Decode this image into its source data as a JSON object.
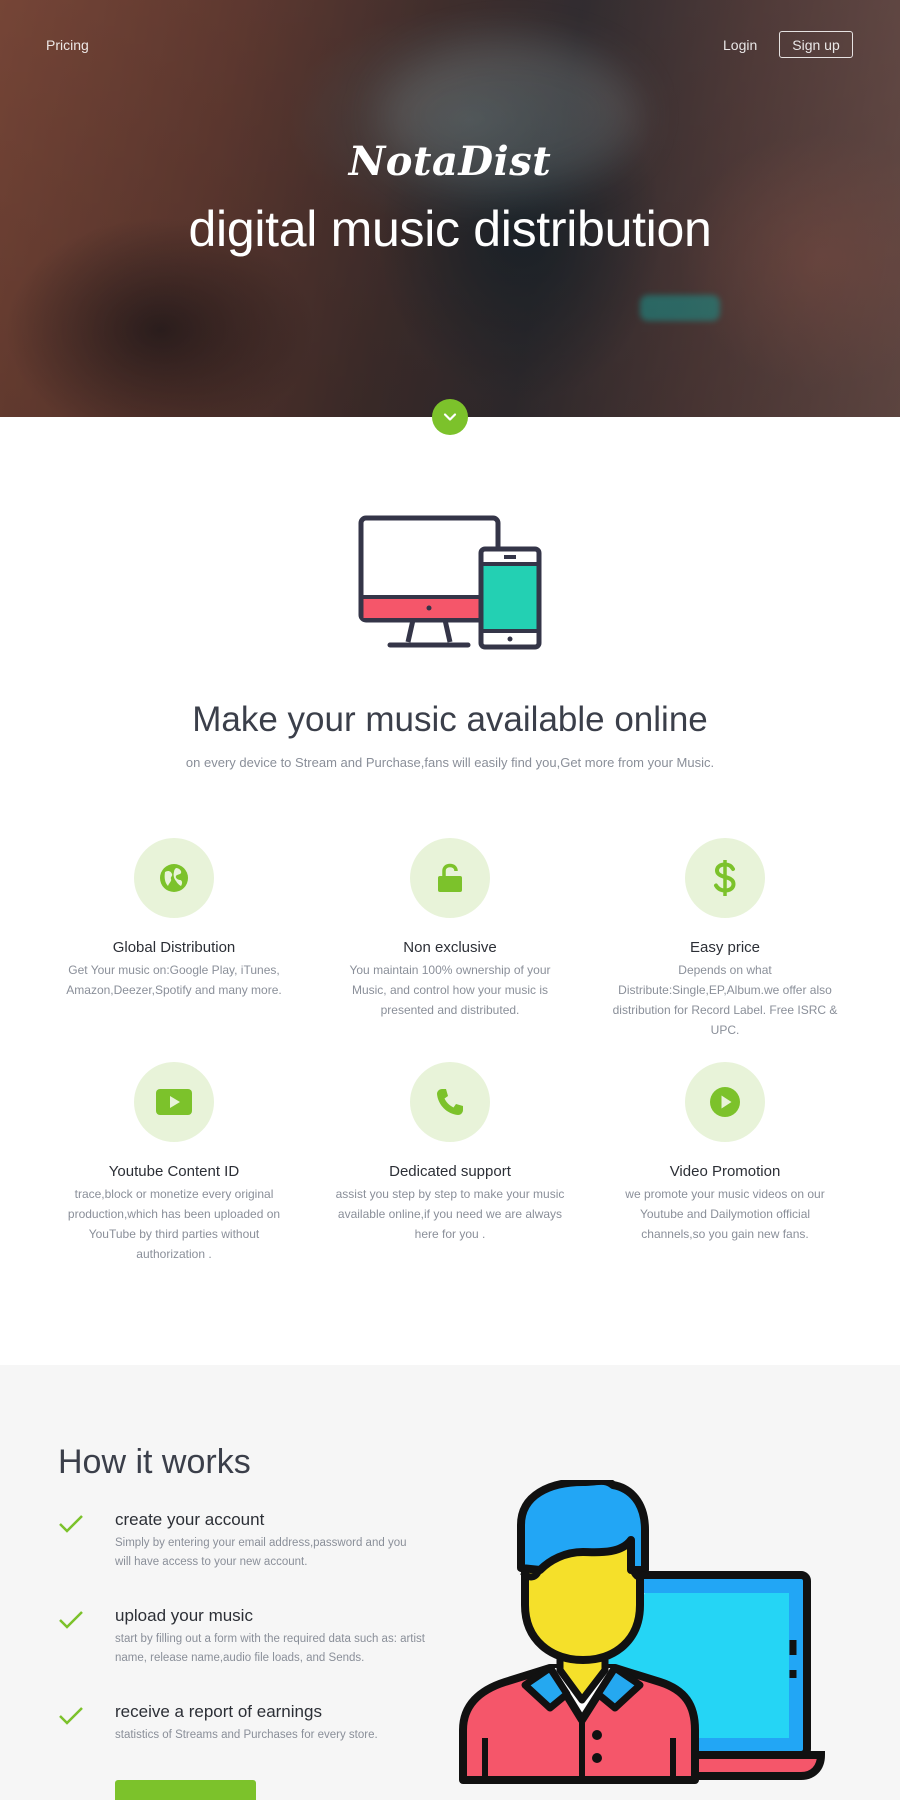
{
  "nav": {
    "pricing": "Pricing",
    "login": "Login",
    "signup": "Sign up"
  },
  "hero": {
    "logo": "NotaDist",
    "title": "digital music distribution",
    "scroll_icon": "chevron-down-icon"
  },
  "intro": {
    "illustration": "devices-icon",
    "title": "Make your music available online",
    "subtitle": "on every device to Stream and Purchase,fans will easily find you,Get more from your Music."
  },
  "features": [
    {
      "icon": "globe-icon",
      "title": "Global Distribution",
      "text": "Get Your music on:Google Play, iTunes, Amazon,Deezer,Spotify and many more."
    },
    {
      "icon": "unlock-icon",
      "title": "Non exclusive",
      "text": "You maintain 100% ownership of your Music, and control how your music is presented and distributed."
    },
    {
      "icon": "dollar-icon",
      "title": "Easy price",
      "text": "Depends on what Distribute:Single,EP,Album.we offer also distribution for Record Label. Free ISRC & UPC."
    },
    {
      "icon": "youtube-icon",
      "title": "Youtube Content ID",
      "text": "trace,block or monetize every original production,which has been uploaded on YouTube by third parties without authorization ."
    },
    {
      "icon": "phone-icon",
      "title": "Dedicated support",
      "text": "assist you step by step to make your music available online,if you need we are always here for you ."
    },
    {
      "icon": "play-icon",
      "title": "Video Promotion",
      "text": "we promote your music videos on our Youtube and Dailymotion official channels,so you gain new fans."
    }
  ],
  "how": {
    "title": "How it works",
    "steps": [
      {
        "title": "create your account",
        "text": "Simply by entering your email address,password and you will have access to your new account."
      },
      {
        "title": "upload your music",
        "text": "start by filling out a form with the required data such as: artist name, release name,audio file loads, and Sends."
      },
      {
        "title": "receive a report of earnings",
        "text": "statistics of Streams and Purchases for every store."
      }
    ],
    "illustration": "person-laptop-icon"
  },
  "colors": {
    "accent": "#7cc22b",
    "accent_light": "#e8f3d9",
    "text_dark": "#3b3f4a",
    "text_muted": "#8a8f99"
  }
}
